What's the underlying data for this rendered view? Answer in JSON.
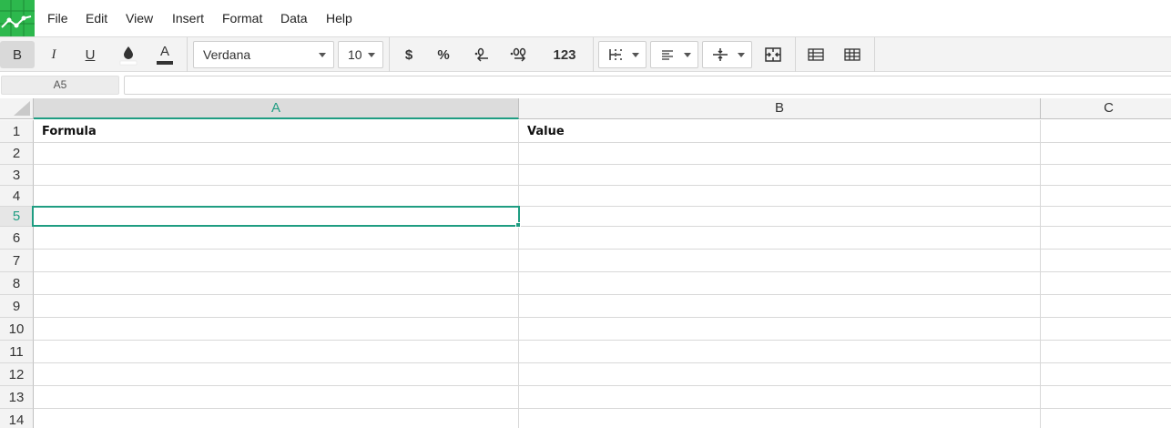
{
  "menu": {
    "items": [
      "File",
      "Edit",
      "View",
      "Insert",
      "Format",
      "Data",
      "Help"
    ]
  },
  "toolbar": {
    "bold_label": "B",
    "italic_label": "I",
    "underline_label": "U",
    "text_color_label": "A",
    "font_family": "Verdana",
    "font_size": "10",
    "currency_label": "$",
    "percent_label": "%",
    "number_format_label": "123",
    "icons": [
      "bold-icon",
      "italic-icon",
      "underline-icon",
      "fill-color-icon",
      "text-color-icon",
      "currency-icon",
      "percent-icon",
      "decrease-decimal-icon",
      "increase-decimal-icon",
      "number-format-icon",
      "borders-icon",
      "horizontal-align-icon",
      "vertical-align-icon",
      "merge-cells-icon",
      "freeze-rows-icon",
      "grid-icon"
    ]
  },
  "formula_bar": {
    "cell_reference": "A5",
    "formula_value": ""
  },
  "grid": {
    "columns": [
      "A",
      "B",
      "C"
    ],
    "rows": [
      "1",
      "2",
      "3",
      "4",
      "5",
      "6",
      "7",
      "8",
      "9",
      "10",
      "11",
      "12",
      "13",
      "14"
    ],
    "cells": {
      "A1": "Formula",
      "B1": "Value"
    },
    "selected_cell": "A5",
    "selected_column": "A",
    "selected_row": "5"
  },
  "colors": {
    "brand": "#2db84d",
    "accent": "#1f9d82",
    "toolbar_bg": "#f3f3f3"
  }
}
